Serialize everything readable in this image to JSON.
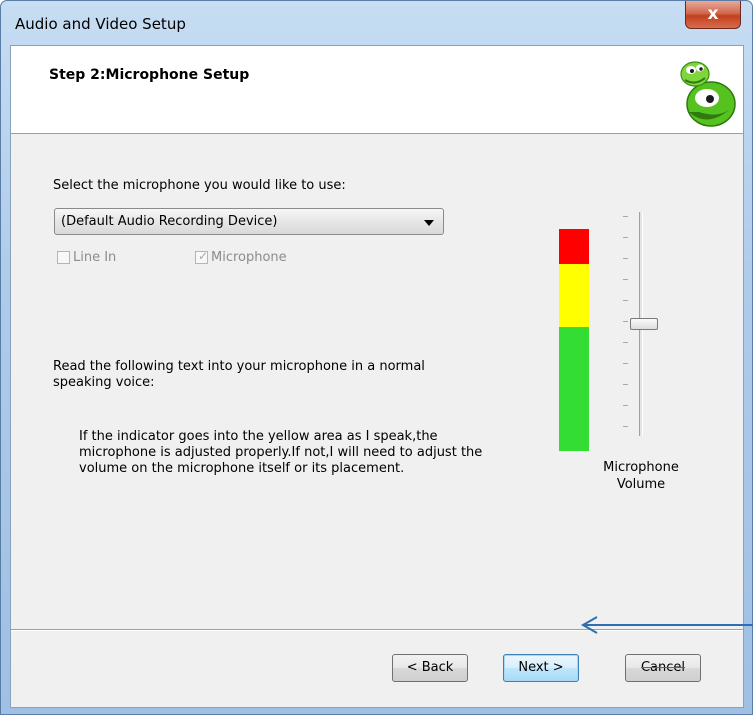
{
  "window": {
    "title": "Audio and Video Setup",
    "close_glyph": "x"
  },
  "header": {
    "step_title": "Step 2:Microphone Setup",
    "logo_icon": "green-smiley-logo-icon"
  },
  "microphone_select": {
    "label": "Select the microphone you would like to use:",
    "selected_value": "(Default Audio Recording Device)"
  },
  "inputs": {
    "line_in_label": "Line In",
    "line_in_checked": false,
    "microphone_label": "Microphone",
    "microphone_checked": true
  },
  "instructions": {
    "label": "Read the following text into your microphone in a normal speaking voice:",
    "text": "If the indicator goes into the yellow area as I speak,the microphone is adjusted properly.If not,I will need to adjust the volume on the microphone itself or its placement."
  },
  "level_meter": {
    "colors": {
      "red": "#ff0000",
      "yellow": "#ffff00",
      "green": "#33dd33"
    }
  },
  "volume": {
    "label_line1": "Microphone",
    "label_line2": "Volume",
    "level_fraction": 0.5
  },
  "buttons": {
    "back": "< Back",
    "next": "Next >",
    "cancel": "Cancel"
  },
  "colors": {
    "title_bar": "#b9d3ee",
    "close_button": "#c94a2c",
    "default_button_border": "#3c7fb1"
  }
}
